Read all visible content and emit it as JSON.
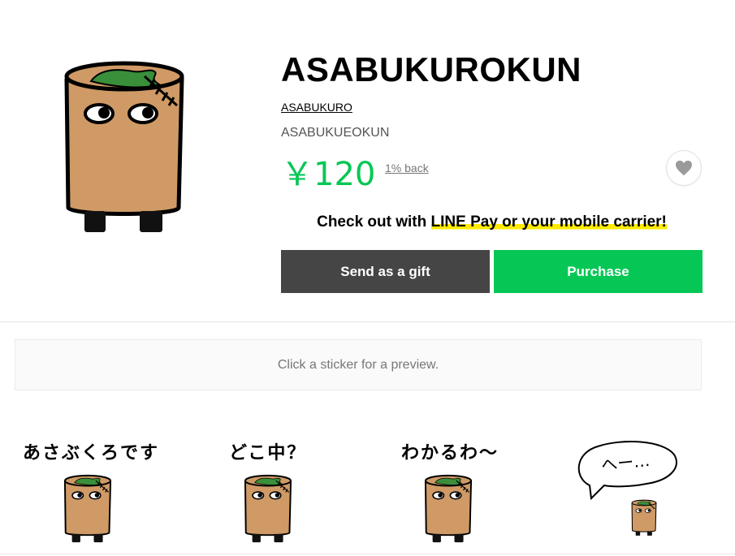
{
  "product": {
    "title": "ASABUKUROKUN",
    "author": "ASABUKURO",
    "subtitle": "ASABUKUEOKUN",
    "price": "￥120",
    "cashback": "1% back",
    "favorite_icon": "heart-icon"
  },
  "checkout": {
    "prefix": "Check out with ",
    "highlight": "LINE Pay or your mobile carrier!"
  },
  "buttons": {
    "gift_label": "Send as a gift",
    "purchase_label": "Purchase"
  },
  "preview": {
    "hint": "Click a sticker for a preview."
  },
  "stickers": [
    {
      "caption": "あさぶくろです"
    },
    {
      "caption": "どこ中？"
    },
    {
      "caption": "わかるわ〜"
    },
    {
      "caption": "へー…"
    }
  ],
  "colors": {
    "accent_green": "#06c755",
    "gift_button": "#454545",
    "highlight_yellow": "#ffeb00",
    "character_body": "#cf9a66",
    "character_leaf": "#3a8f3a"
  }
}
